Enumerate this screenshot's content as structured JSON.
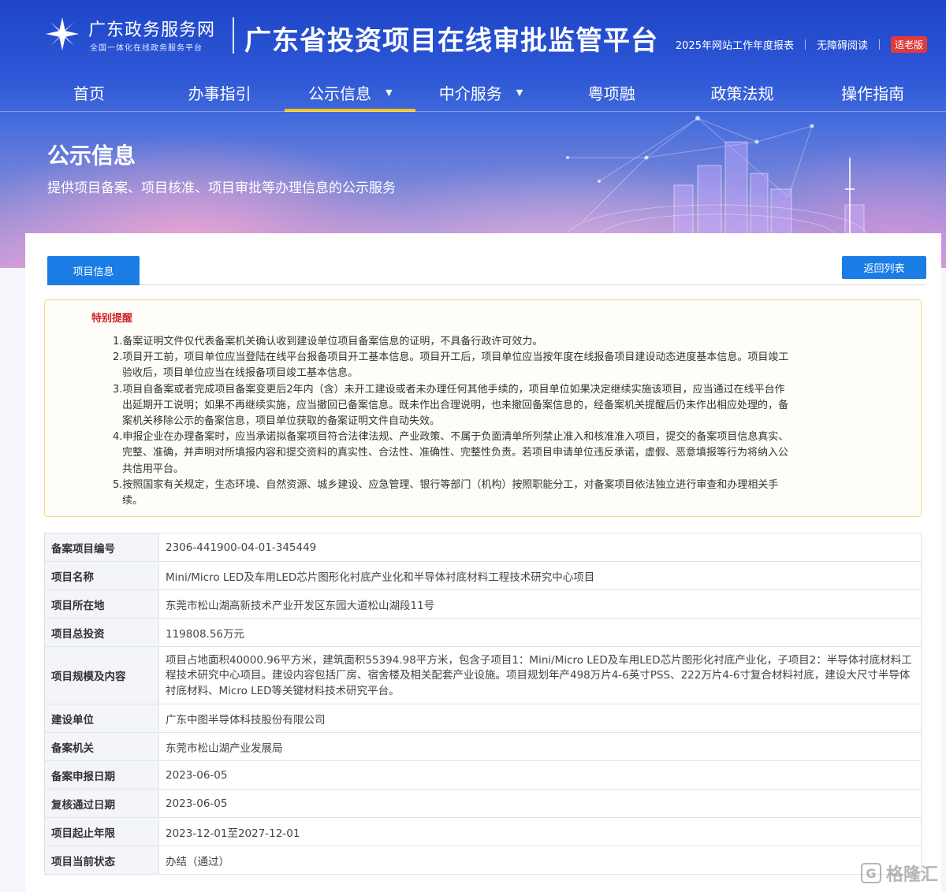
{
  "header": {
    "logo_name": "广东政务服务网",
    "logo_sub": "全国一体化在线政务服务平台",
    "platform_title": "广东省投资项目在线审批监管平台",
    "links": [
      "2025年网站工作年度报表",
      "无障碍阅读"
    ],
    "elder_mode": "适老版"
  },
  "nav": {
    "items": [
      {
        "label": "首页"
      },
      {
        "label": "办事指引"
      },
      {
        "label": "公示信息"
      },
      {
        "label": "中介服务"
      },
      {
        "label": "粤项融"
      },
      {
        "label": "政策法规"
      },
      {
        "label": "操作指南"
      }
    ],
    "active_index": 2
  },
  "banner": {
    "title": "公示信息",
    "subtitle": "提供项目备案、项目核准、项目审批等办理信息的公示服务"
  },
  "tab": {
    "label": "项目信息",
    "back_label": "返回列表"
  },
  "notice": {
    "title": "特别提醒",
    "items": [
      "1.备案证明文件仅代表备案机关确认收到建设单位项目备案信息的证明，不具备行政许可效力。",
      "2.项目开工前，项目单位应当登陆在线平台报备项目开工基本信息。项目开工后，项目单位应当按年度在线报备项目建设动态进度基本信息。项目竣工验收后，项目单位应当在线报备项目竣工基本信息。",
      "3.项目自备案或者完成项目备案变更后2年内（含）未开工建设或者未办理任何其他手续的，项目单位如果决定继续实施该项目，应当通过在线平台作出延期开工说明；如果不再继续实施，应当撤回已备案信息。既未作出合理说明，也未撤回备案信息的，经备案机关提醒后仍未作出相应处理的，备案机关移除公示的备案信息，项目单位获取的备案证明文件自动失效。",
      "4.申报企业在办理备案时，应当承诺拟备案项目符合法律法规、产业政策、不属于负面清单所列禁止准入和核准准入项目，提交的备案项目信息真实、完整、准确，并声明对所填报内容和提交资料的真实性、合法性、准确性、完整性负责。若项目申请单位违反承诺，虚假、恶意填报等行为将纳入公共信用平台。",
      "5.按照国家有关规定，生态环境、自然资源、城乡建设、应急管理、银行等部门（机构）按照职能分工，对备案项目依法独立进行审查和办理相关手续。"
    ]
  },
  "project": {
    "rows": [
      {
        "key": "备案项目编号",
        "value": "2306-441900-04-01-345449"
      },
      {
        "key": "项目名称",
        "value": "Mini/Micro LED及车用LED芯片图形化衬底产业化和半导体衬底材料工程技术研究中心项目"
      },
      {
        "key": "项目所在地",
        "value": "东莞市松山湖高新技术产业开发区东园大道松山湖段11号"
      },
      {
        "key": "项目总投资",
        "value": "119808.56万元"
      },
      {
        "key": "项目规模及内容",
        "value": "项目占地面积40000.96平方米，建筑面积55394.98平方米，包含子项目1：Mini/Micro LED及车用LED芯片图形化衬底产业化，子项目2：半导体衬底材料工程技术研究中心项目。建设内容包括厂房、宿舍楼及相关配套产业设施。项目规划年产498万片4-6英寸PSS、222万片4-6寸复合材料衬底，建设大尺寸半导体衬底材料、Micro LED等关键材料技术研究平台。"
      },
      {
        "key": "建设单位",
        "value": "广东中图半导体科技股份有限公司"
      },
      {
        "key": "备案机关",
        "value": "东莞市松山湖产业发展局"
      },
      {
        "key": "备案申报日期",
        "value": "2023-06-05"
      },
      {
        "key": "复核通过日期",
        "value": "2023-06-05"
      },
      {
        "key": "项目起止年限",
        "value": "2023-12-01至2027-12-01"
      },
      {
        "key": "项目当前状态",
        "value": "办结（通过）"
      }
    ]
  },
  "watermark": "格隆汇",
  "colors": {
    "primary": "#1a7de6",
    "nav_active": "#f5c518",
    "notice_title": "#d0262b",
    "elder_badge": "#e23a3a"
  }
}
